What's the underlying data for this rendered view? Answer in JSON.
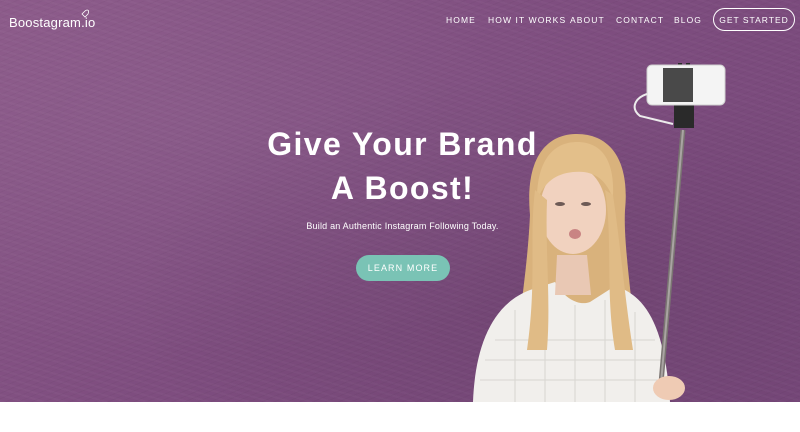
{
  "nav": {
    "logo": "Boostagram.io",
    "items": [
      "HOME",
      "HOW IT WORKS",
      "ABOUT",
      "CONTACT",
      "BLOG"
    ],
    "cta_label": "GET STARTED"
  },
  "hero": {
    "headline_line1": "Give Your Brand",
    "headline_line2": "A Boost!",
    "subtitle": "Build an Authentic Instagram Following Today.",
    "button_label": "LEARN MORE",
    "accent_color": "#7ac3b5",
    "background_color": "#7e4d7f"
  }
}
